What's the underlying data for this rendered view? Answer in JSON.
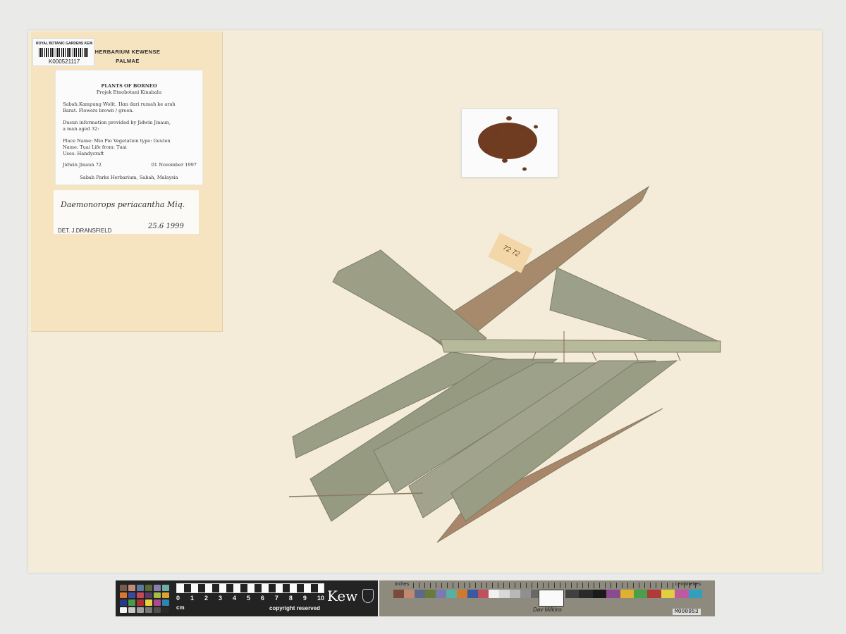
{
  "institution_tag": {
    "org": "ROYAL BOTANIC GARDENS KEW",
    "barcode": "K000521117"
  },
  "herbarium": {
    "line1": "HERBARIUM KEWENSE",
    "line2": "PALMAE"
  },
  "locality_label": {
    "title": "PLANTS OF BORNEO",
    "subtitle": "Projek Etnobotani Kinabalu",
    "locality": "Sabah.Kampung Wolit. 1km dari rumah ke arah\nBarat. Flowers brown / green.",
    "informant": "Dusun information provided by Jidwin Jinaun,\na man aged 32:",
    "uses": "Place Name: Mio Pio  Vegetation type: Geuten\nName: Tuai  Life from: Tuai\nUses: Handycraft",
    "collector": "Jidwin Jinaun 72",
    "date": "01 November 1997",
    "footer": "Sabah Parks Herbarium, Sabah, Malaysia"
  },
  "determination": {
    "name": "Daemonorops periacantha Miq.",
    "det": "DET.  J.DRANSFIELD",
    "date": "25.6 1999"
  },
  "number_tag": "72 72",
  "color_bar": {
    "ticks": [
      "0",
      "1",
      "2",
      "3",
      "4",
      "5",
      "6",
      "7",
      "8",
      "9",
      "10"
    ],
    "unit": "cm",
    "copyright": "copyright reserved",
    "brand": "Kew"
  },
  "scale_bar": {
    "inches": "inches",
    "centimetres": "centimetres",
    "signature": "Dav Milkins",
    "id": "M000953"
  },
  "colors": {
    "sheet": "#f4ecd9",
    "folder": "#f6e3bf",
    "leaf": "#9a9e85",
    "leaf_brown": "#a88466",
    "seeds": "#6b3a22"
  }
}
